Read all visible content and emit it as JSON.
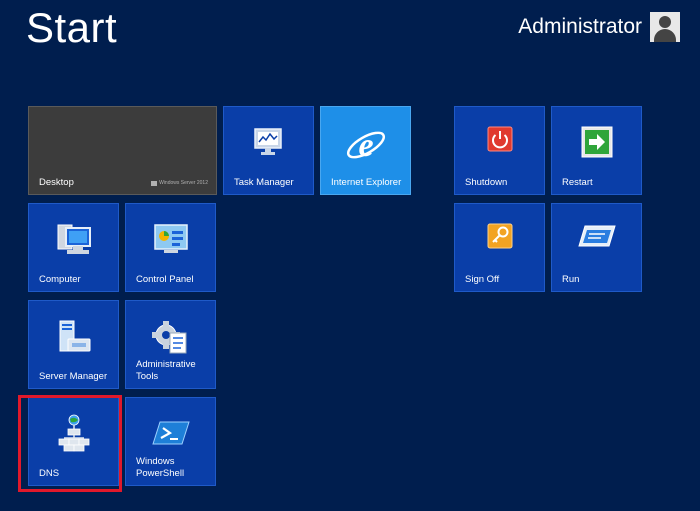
{
  "header": {
    "title": "Start",
    "user": "Administrator"
  },
  "desktop_brand": "Windows Server 2012",
  "tiles": {
    "desktop": "Desktop",
    "task_manager": "Task Manager",
    "internet_explorer": "Internet Explorer",
    "shutdown": "Shutdown",
    "restart": "Restart",
    "computer": "Computer",
    "control_panel": "Control Panel",
    "sign_off": "Sign Off",
    "run": "Run",
    "server_manager": "Server Manager",
    "admin_tools": "Administrative\nTools",
    "dns": "DNS",
    "powershell": "Windows\nPowerShell"
  },
  "icons": {
    "task_manager": "monitor-chart-icon",
    "internet_explorer": "ie-logo-icon",
    "shutdown": "power-icon",
    "restart": "green-arrow-icon",
    "computer": "computer-icon",
    "control_panel": "control-panel-icon",
    "sign_off": "key-icon",
    "run": "run-window-icon",
    "server_manager": "server-icon",
    "admin_tools": "gear-checklist-icon",
    "dns": "network-globe-icon",
    "powershell": "powershell-icon"
  },
  "colors": {
    "background": "#001e4e",
    "tile": "#0a3ea8",
    "desktop_tile": "#3c3c3c",
    "ie_tile": "#1e8fe8",
    "highlight": "#e0192b"
  }
}
